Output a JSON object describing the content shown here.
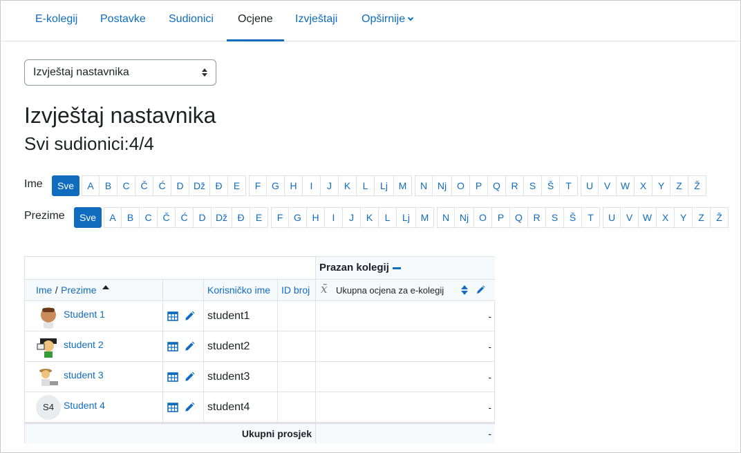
{
  "nav": {
    "tabs": [
      {
        "label": "E-kolegij"
      },
      {
        "label": "Postavke"
      },
      {
        "label": "Sudionici"
      },
      {
        "label": "Ocjene"
      },
      {
        "label": "Izvještaji"
      },
      {
        "label": "Opširnije"
      }
    ],
    "active_tab": "Ocjene"
  },
  "report_select": {
    "value": "Izvještaj nastavnika"
  },
  "page": {
    "title": "Izvještaj nastavnika",
    "subtitle": "Svi sudionici:4/4"
  },
  "filters": {
    "first_name_label": "Ime",
    "last_name_label": "Prezime",
    "all_label": "Sve",
    "letters": [
      "A",
      "B",
      "C",
      "Č",
      "Ć",
      "D",
      "Dž",
      "Đ",
      "E",
      "F",
      "G",
      "H",
      "I",
      "J",
      "K",
      "L",
      "Lj",
      "M",
      "N",
      "Nj",
      "O",
      "P",
      "Q",
      "R",
      "S",
      "Š",
      "T",
      "U",
      "V",
      "W",
      "X",
      "Y",
      "Z",
      "Ž"
    ]
  },
  "table": {
    "category_header": "Prazan kolegij",
    "col_first_name": "Ime",
    "col_sep": "/",
    "col_last_name": "Prezime",
    "col_username": "Korisničko ime",
    "col_idnumber": "ID broj",
    "col_total": "Ukupna ocjena za e-kolegij",
    "rows": [
      {
        "name": "Student 1",
        "username": "student1",
        "grade": "-"
      },
      {
        "name": "student 2",
        "username": "student2",
        "grade": "-"
      },
      {
        "name": "student 3",
        "username": "student3",
        "grade": "-"
      },
      {
        "name": "Student 4",
        "username": "student4",
        "grade": "-",
        "initials": "S4"
      }
    ],
    "footer_label": "Ukupni prosjek",
    "footer_value": "-"
  },
  "colors": {
    "accent": "#0f6cbf",
    "header_bg": "#f5f9fc",
    "border": "#dee2e6"
  }
}
